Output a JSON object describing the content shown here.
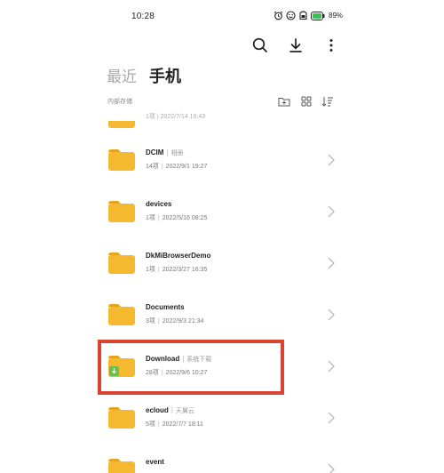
{
  "status": {
    "time": "10:28",
    "battery": "89%"
  },
  "toolbar": {
    "search_icon": "search-icon",
    "download_icon": "download-icon",
    "more_icon": "more-vertical-icon"
  },
  "tabs": [
    {
      "label": "最近",
      "active": false
    },
    {
      "label": "手机",
      "active": true
    }
  ],
  "path": {
    "label": "内部存储"
  },
  "folders": [
    {
      "name": "DCIM",
      "tag": "相册",
      "count": "14项",
      "date": "2022/9/1 19:27",
      "special": false
    },
    {
      "name": "devices",
      "tag": "",
      "count": "1项",
      "date": "2022/5/16 08:25",
      "special": false
    },
    {
      "name": "DkMiBrowserDemo",
      "tag": "",
      "count": "1项",
      "date": "2022/3/27 16:35",
      "special": false
    },
    {
      "name": "Documents",
      "tag": "",
      "count": "3项",
      "date": "2022/9/3 21:34",
      "special": false
    },
    {
      "name": "Download",
      "tag": "系统下载",
      "count": "28项",
      "date": "2022/9/6 10:27",
      "special": true
    },
    {
      "name": "ecloud",
      "tag": "天翼云",
      "count": "5项",
      "date": "2022/7/7 18:11",
      "special": false
    },
    {
      "name": "event",
      "tag": "",
      "count": "",
      "date": "",
      "special": false
    }
  ],
  "partial_top_meta": "1项 | 2022/7/14 16:43",
  "colors": {
    "folder": "#f5b92f",
    "folder_tab": "#e6a41e",
    "download_badge": "#6ac04a",
    "highlight": "#d9432f"
  }
}
